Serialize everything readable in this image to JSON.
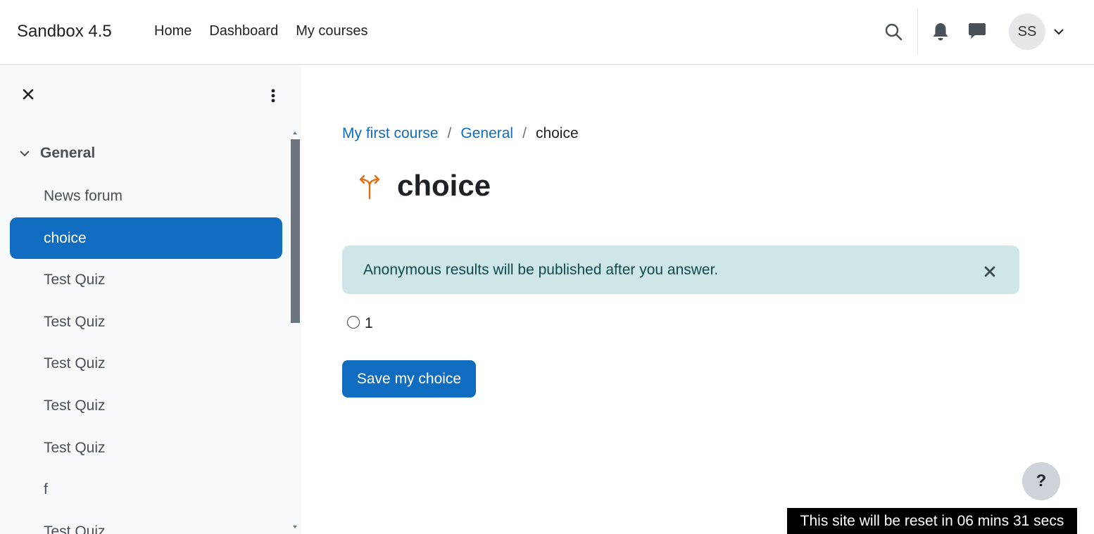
{
  "navbar": {
    "site_name": "Sandbox 4.5",
    "links": [
      "Home",
      "Dashboard",
      "My courses"
    ],
    "user_initials": "SS",
    "icons": [
      "search-icon",
      "bell-icon",
      "chat-icon",
      "chevron-down-icon"
    ]
  },
  "drawer": {
    "section": "General",
    "items": [
      "News forum",
      "choice",
      "Test Quiz",
      "Test Quiz",
      "Test Quiz",
      "Test Quiz",
      "Test Quiz",
      "f",
      "Test Quiz"
    ],
    "active_index": 1
  },
  "breadcrumb": {
    "items": [
      "My first course",
      "General"
    ],
    "current": "choice",
    "separator": "/"
  },
  "page": {
    "title": "choice",
    "alert": "Anonymous results will be published after you answer.",
    "option_label": "1",
    "save_label": "Save my choice"
  },
  "footer": {
    "help": "?",
    "reset_notice": "This site will be reset in 06 mins 31 secs"
  },
  "colors": {
    "primary": "#0f6cbf",
    "alert_bg": "#cfe6e8",
    "activity_icon": "#e06e12"
  }
}
